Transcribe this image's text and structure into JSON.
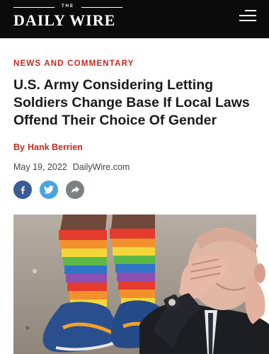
{
  "header": {
    "logo_the": "THE",
    "logo_word": "DAILY WIRE",
    "menu_icon": "hamburger-menu-icon",
    "background": "#0b0b0b"
  },
  "article": {
    "category": "NEWS AND COMMENTARY",
    "headline": "U.S. Army Considering Letting Soldiers Change Base If Local Laws Offend Their Choice Of Gender",
    "byline_prefix": "By",
    "author": "Hank Berrien",
    "date": "May 19, 2022",
    "site": "DailyWire.com"
  },
  "share": {
    "facebook_icon": "facebook-icon",
    "twitter_icon": "twitter-icon",
    "share_icon": "share-arrow-icon"
  },
  "colors": {
    "accent": "#c8281e",
    "facebook": "#3b5b98",
    "twitter": "#4aa3dd",
    "share": "#7d8183"
  }
}
